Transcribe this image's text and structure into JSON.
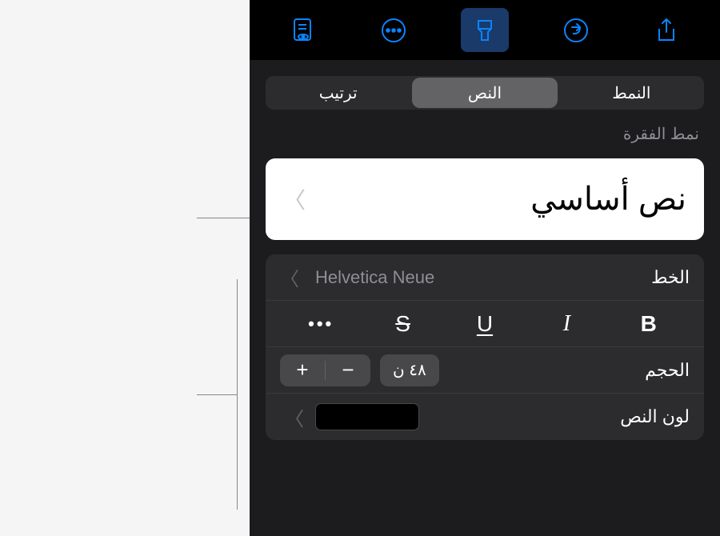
{
  "toolbar": {
    "icons": [
      "document-view",
      "more-circle",
      "brush",
      "redo-circle",
      "share"
    ]
  },
  "tabs": {
    "style": "النمط",
    "text": "النص",
    "arrange": "ترتيب"
  },
  "paragraph_style": {
    "label": "نمط الفقرة",
    "value": "نص أساسي"
  },
  "font": {
    "label": "الخط",
    "value": "Helvetica Neue"
  },
  "format": {
    "bold": "B",
    "italic": "I",
    "underline": "U",
    "strike": "S",
    "more": "•••"
  },
  "size": {
    "label": "الحجم",
    "value": "٤٨ ن",
    "plus": "+",
    "minus": "−"
  },
  "text_color": {
    "label": "لون النص",
    "value": "#000000"
  }
}
